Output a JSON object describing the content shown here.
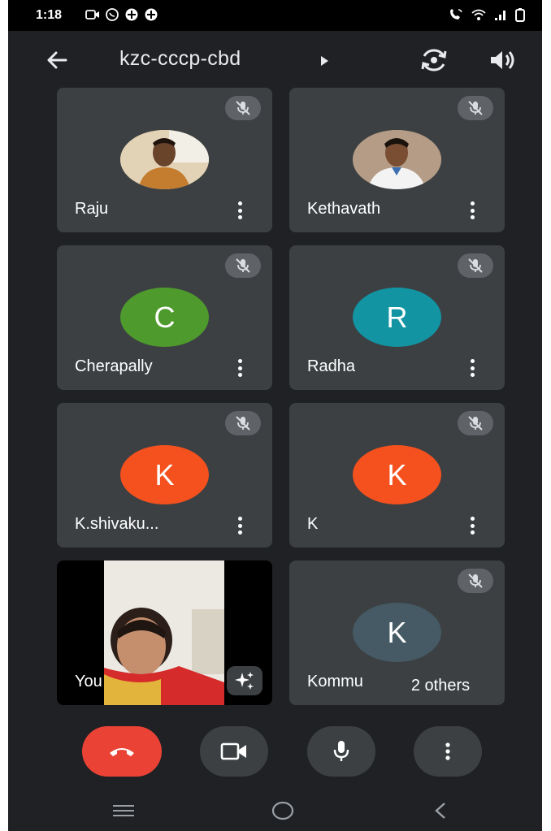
{
  "status_bar": {
    "time": "1:18",
    "left_icons": [
      "video-call-icon",
      "whatsapp-icon",
      "game-controller-icon",
      "game-controller-icon"
    ],
    "right_icons": [
      "wifi-calling-icon",
      "wifi-icon",
      "signal-icon",
      "battery-icon"
    ]
  },
  "header": {
    "meeting_code": "kzc-cccp-cbd"
  },
  "tiles": [
    {
      "name": "Raju",
      "type": "photo",
      "muted": true
    },
    {
      "name": "Kethavath",
      "type": "photo",
      "muted": true
    },
    {
      "name": "Cherapally",
      "type": "initial",
      "initial": "C",
      "color": "#4e9a2c",
      "muted": true
    },
    {
      "name": "Radha",
      "type": "initial",
      "initial": "R",
      "color": "#1294a3",
      "muted": true
    },
    {
      "name": "K.shivaku...",
      "type": "initial",
      "initial": "K",
      "color": "#f4511e",
      "muted": true
    },
    {
      "name": "K",
      "type": "initial",
      "initial": "K",
      "color": "#f4511e",
      "muted": true
    },
    {
      "name": "You",
      "type": "self-video",
      "muted": false
    },
    {
      "name": "Kommu",
      "type": "initial",
      "initial": "K",
      "color": "#455a64",
      "muted": true
    }
  ],
  "others_chip": "2 others",
  "colors": {
    "background": "#202124",
    "tile": "#3c4043",
    "end_call": "#ea4335"
  },
  "controls": [
    "end-call",
    "camera",
    "microphone",
    "more-options"
  ],
  "nav": [
    "recents-icon",
    "home-icon",
    "back-icon"
  ]
}
